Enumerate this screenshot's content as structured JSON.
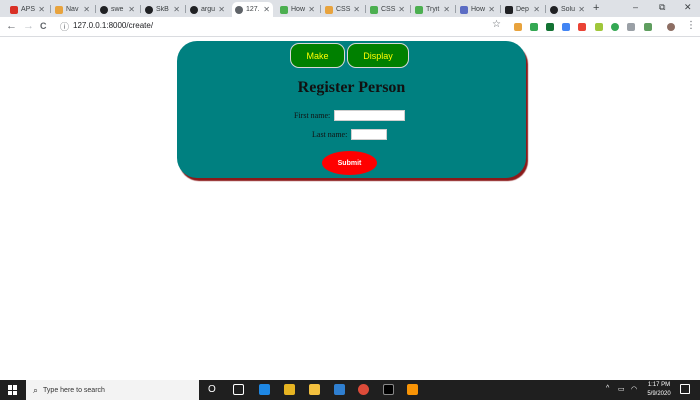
{
  "tabs": [
    {
      "title": "APS",
      "icon": "gmail-icon",
      "color": "#d93025"
    },
    {
      "title": "Nav",
      "icon": "document-icon",
      "color": "#e8a33d"
    },
    {
      "title": "swe",
      "icon": "github-icon",
      "color": "#202124"
    },
    {
      "title": "SkB",
      "icon": "github-icon",
      "color": "#202124"
    },
    {
      "title": "argu",
      "icon": "github-icon",
      "color": "#202124"
    },
    {
      "title": "127.",
      "icon": "globe-icon",
      "color": "#5f6368"
    },
    {
      "title": "How",
      "icon": "w3schools-icon",
      "color": "#4caf50"
    },
    {
      "title": "CSS",
      "icon": "document-icon",
      "color": "#e8a33d"
    },
    {
      "title": "CSS",
      "icon": "w3schools-icon",
      "color": "#4caf50"
    },
    {
      "title": "Tryit",
      "icon": "w3schools-icon",
      "color": "#4caf50"
    },
    {
      "title": "How",
      "icon": "hackernoon-icon",
      "color": "#5b6cc4"
    },
    {
      "title": "Dep",
      "icon": "book-icon",
      "color": "#202124"
    },
    {
      "title": "Solu",
      "icon": "github-icon",
      "color": "#202124"
    }
  ],
  "browser": {
    "url": "127.0.0.1:8000/create/",
    "back": "←",
    "forward": "→",
    "reload": "C",
    "new_tab": "+",
    "minimize": "–",
    "maximize": "⧉",
    "close": "✕",
    "menu": "⋮",
    "star": "☆"
  },
  "page": {
    "nav_make": "Make",
    "nav_display": "Display",
    "heading": "Register Person",
    "first_name_label": "First name:",
    "first_name_value": "",
    "last_name_label": "Last name:",
    "last_name_value": "",
    "submit": "Submit",
    "colors": {
      "card": "#008080",
      "nav_button": "#008000",
      "nav_text": "#ffff00",
      "submit": "#ff0000",
      "shadow": "#8b1a1a"
    }
  },
  "taskbar": {
    "search_placeholder": "Type here to search",
    "cortana": "O",
    "time": "1:17 PM",
    "date": "5/9/2020",
    "tray_chevron": "^"
  }
}
